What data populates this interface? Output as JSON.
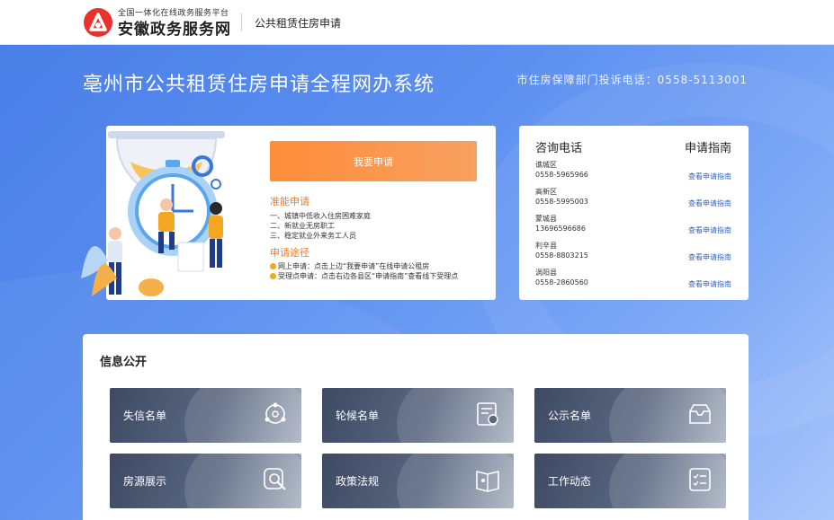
{
  "header": {
    "brand_small": "全国一体化在线政务服务平台",
    "brand_name": "安徽政务服务网",
    "sub_title": "公共租赁住房申请"
  },
  "banner": {
    "title": "亳州市公共租赁住房申请全程网办系统",
    "complaint": "市住房保障部门投诉电话：0558-5113001"
  },
  "apply": {
    "button_label": "我要申请",
    "conditions_title": "准能申请",
    "conditions": [
      "一、城镇中低收入住房困难家庭",
      "二、新就业无房职工",
      "三、稳定就业外来务工人员"
    ],
    "routes_title": "申请途径",
    "routes": [
      "网上申请：点击上边“我要申请”在线申请公租房",
      "受理点申请：点击右边各县区“申请指南”查看线下受理点"
    ]
  },
  "contact": {
    "title": "咨询电话",
    "guide_title": "申请指南",
    "districts": [
      {
        "name": "谯城区",
        "phone": "0558-5965966",
        "link": "查看申请指南"
      },
      {
        "name": "高新区",
        "phone": "0558-5995003",
        "link": "查看申请指南"
      },
      {
        "name": "蒙城县",
        "phone": "13696596686",
        "link": "查看申请指南"
      },
      {
        "name": "利辛县",
        "phone": "0558-8803215",
        "link": "查看申请指南"
      },
      {
        "name": "涡阳县",
        "phone": "0558-2860560",
        "link": "查看申请指南"
      }
    ]
  },
  "info": {
    "title": "信息公开",
    "tiles": [
      {
        "label": "失信名单",
        "icon": "network-search-icon"
      },
      {
        "label": "轮候名单",
        "icon": "certificate-icon"
      },
      {
        "label": "公示名单",
        "icon": "inbox-icon"
      },
      {
        "label": "房源展示",
        "icon": "search-doc-icon"
      },
      {
        "label": "政策法规",
        "icon": "book-icon"
      },
      {
        "label": "工作动态",
        "icon": "checklist-icon"
      }
    ]
  },
  "colors": {
    "accent": "#ff8e3a",
    "brand_red": "#e8322b",
    "link": "#2c62c9",
    "banner": "#4a7fe8"
  }
}
